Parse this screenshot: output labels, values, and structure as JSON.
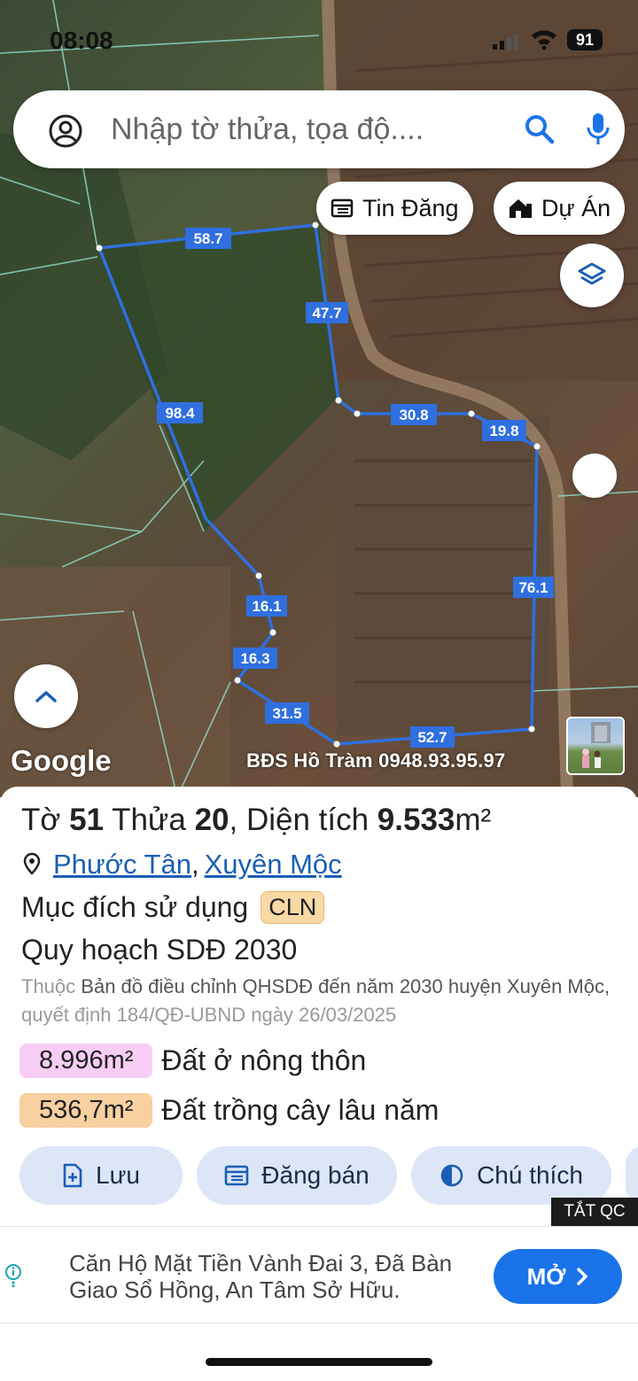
{
  "status_bar": {
    "time": "08:08",
    "battery": "91"
  },
  "search": {
    "placeholder": "Nhập tờ thửa, tọa độ...."
  },
  "map": {
    "pill_listings": "Tin Đăng",
    "pill_projects": "Dự Án",
    "edge_labels": [
      "58.7",
      "47.7",
      "98.4",
      "30.8",
      "19.8",
      "76.1",
      "16.1",
      "16.3",
      "31.5",
      "52.7"
    ],
    "google": "Google",
    "watermark": "BĐS Hồ Tràm 0948.93.95.97"
  },
  "parcel": {
    "to_label": "Tờ ",
    "to_number": "51",
    "thua_label": " Thửa ",
    "thua_number": "20",
    "area_label": ", Diện tích ",
    "area_value": "9.533",
    "area_unit": "m²",
    "ward": "Phước Tân",
    "separator": ",",
    "district": "Xuyên Mộc",
    "purpose_label": "Mục đích sử dụng",
    "purpose_code": "CLN",
    "plan_title": "Quy hoạch SDĐ 2030",
    "plan_prefix": "Thuộc",
    "plan_doc": "Bản đồ điều chỉnh QHSDĐ đến năm 2030 huyện Xuyên Mộc,",
    "plan_decision": "quyết định 184/QĐ-UBND ngày 26/03/2025",
    "zones": [
      {
        "area": "8.996m²",
        "name": "Đất ở nông thôn",
        "color": "#f8cdf5"
      },
      {
        "area": "536,7m²",
        "name": "Đất trồng cây lâu năm",
        "color": "#f9d0a0"
      }
    ]
  },
  "actions": {
    "save": "Lưu",
    "post": "Đăng bán",
    "legend": "Chú thích"
  },
  "ad": {
    "close_label": "TẮT QC",
    "line1": "Căn Hộ Mặt Tiền Vành Đai 3, Đã Bàn",
    "line2": "Giao Sổ Hồng, An Tâm Sở Hữu.",
    "open_label": "MỞ"
  },
  "colors": {
    "accent": "#1a73e8",
    "boundary": "#2f6fe0",
    "action_bg": "#dce6f7"
  }
}
